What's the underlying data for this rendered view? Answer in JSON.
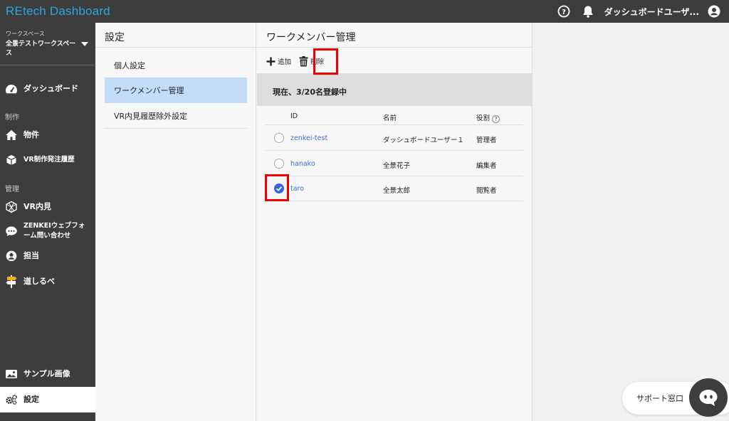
{
  "app": {
    "title": "REtech Dashboard"
  },
  "header": {
    "user_name": "ダッシュボードユーザ..."
  },
  "workspace": {
    "label": "ワークスペース",
    "name": "全景テストワークスペース"
  },
  "sidebar": {
    "items": [
      {
        "label": "ダッシュボード",
        "icon": "dashboard-gauge-icon"
      },
      {
        "section": "制作"
      },
      {
        "label": "物件",
        "icon": "home-icon"
      },
      {
        "label": "VR制作発注履歴",
        "icon": "box-icon"
      },
      {
        "section": "管理"
      },
      {
        "label": "VR内見",
        "icon": "vr-icon"
      },
      {
        "label": "ZENKEIウェブフォーム問い合わせ",
        "icon": "chat-icon"
      },
      {
        "label": "担当",
        "icon": "person-icon"
      },
      {
        "label": "道しるべ",
        "icon": "signpost-icon"
      },
      {
        "label": "サンプル画像",
        "icon": "image-icon"
      },
      {
        "label": "設定",
        "icon": "gears-icon"
      }
    ]
  },
  "settings": {
    "title": "設定",
    "items": [
      "個人設定",
      "ワークメンバー管理",
      "VR内見履歴除外設定"
    ],
    "active_index": 1
  },
  "main": {
    "title": "ワークメンバー管理",
    "toolbar": {
      "add_label": "追加",
      "delete_label": "削除"
    },
    "banner": "現在、3/20名登録中",
    "table": {
      "headers": {
        "id": "ID",
        "name": "名前",
        "role": "役割"
      },
      "rows": [
        {
          "id": "zenkei-test",
          "name": "ダッシュボードユーザー１",
          "role": "管理者",
          "checked": false
        },
        {
          "id": "hanako",
          "name": "全景花子",
          "role": "編集者",
          "checked": false
        },
        {
          "id": "taro",
          "name": "全景太郎",
          "role": "閲覧者",
          "checked": true
        }
      ]
    }
  },
  "support": {
    "label": "サポート窓口"
  },
  "colors": {
    "brand": "#29a8e0",
    "sidebar_bg": "#3d3d3d",
    "active_item_bg": "#c3dcf7",
    "highlight": "#ee0000",
    "link": "#3a6fc6"
  }
}
